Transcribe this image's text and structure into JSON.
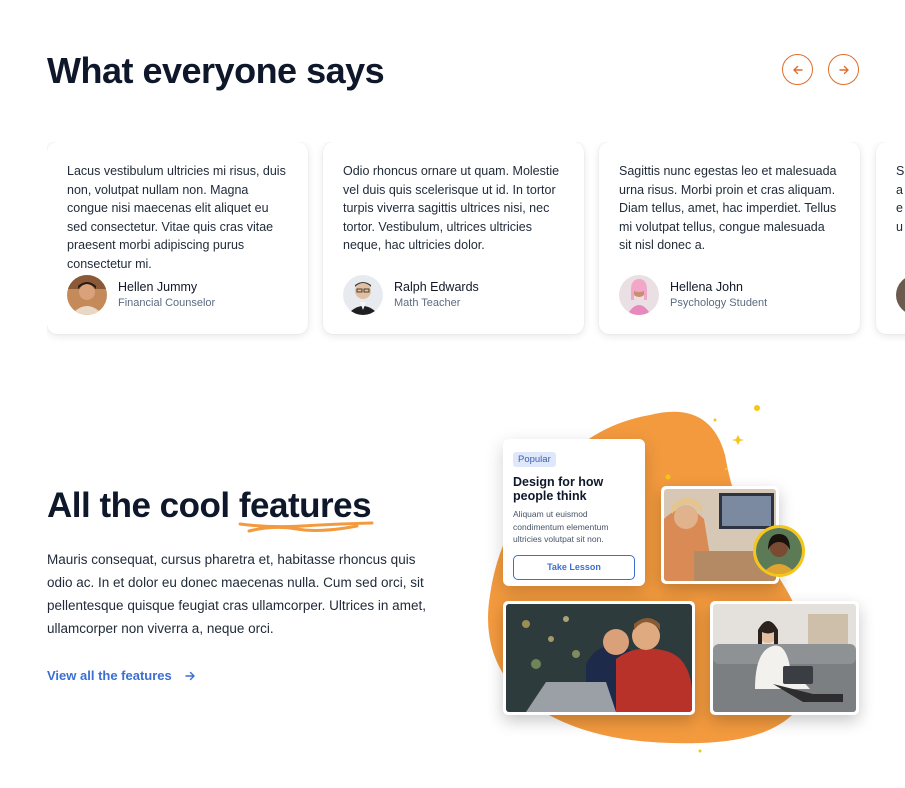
{
  "testimonials": {
    "title": "What everyone says",
    "prev_icon": "arrow-left-icon",
    "next_icon": "arrow-right-icon",
    "accent": "#e06d2a",
    "cards": [
      {
        "text": "Lacus vestibulum ultricies mi risus, duis non, volutpat nullam non. Magna congue nisi maecenas elit aliquet eu sed consectetur. Vitae quis cras vitae praesent morbi adipiscing purus consectetur mi.",
        "name": "Hellen Jummy",
        "role": "Financial Counselor"
      },
      {
        "text": "Odio rhoncus ornare ut quam. Molestie vel duis quis scelerisque ut id. In tortor turpis viverra sagittis ultrices nisi, nec tortor. Vestibulum, ultrices ultricies neque, hac ultricies dolor.",
        "name": "Ralph Edwards",
        "role": "Math Teacher"
      },
      {
        "text": "Sagittis nunc egestas leo et malesuada urna risus. Morbi proin et cras aliquam. Diam tellus, amet, hac imperdiet. Tellus mi volutpat tellus, congue malesuada sit nisl donec a.",
        "name": "Hellena John",
        "role": "Psychology Student"
      },
      {
        "text": "Sa a ne nu",
        "name": "",
        "role": ""
      }
    ]
  },
  "features": {
    "title_pre": "All the cool",
    "title_highlight": "features",
    "description": "Mauris consequat, cursus pharetra et, habitasse rhoncus quis odio ac. In et dolor eu donec maecenas nulla. Cum sed orci, sit pellentesque quisque feugiat cras ullamcorper. Ultrices in amet, ullamcorper non viverra a, neque orci.",
    "link_label": "View all the features",
    "link_icon": "arrow-right-icon",
    "link_color": "#3b6fd1",
    "blob_color": "#f39a3e"
  },
  "lesson_card": {
    "badge": "Popular",
    "title": "Design for how people think",
    "description": "Aliquam ut euismod condimentum elementum ultricies volutpat sit non.",
    "button": "Take Lesson"
  }
}
